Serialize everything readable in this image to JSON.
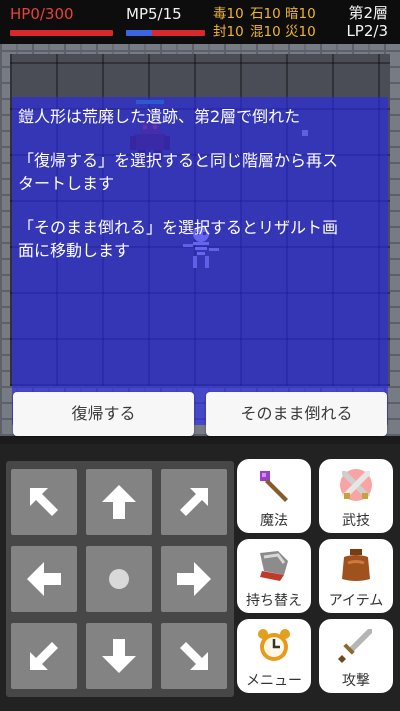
{
  "hud": {
    "hp": "HP0/300",
    "mp": "MP5/15",
    "hp_fraction": 0,
    "mp_fraction": 0.333,
    "status_row1": [
      "毒10",
      "石10",
      "暗10"
    ],
    "status_row2": [
      "封10",
      "混10",
      "災10"
    ],
    "floor": "第2層",
    "lp": "LP2/3",
    "colors": {
      "hp": "#e8413a",
      "status": "#f0b52c",
      "mp_fill": "#3a64e0",
      "bar_empty": "#d8282b"
    }
  },
  "dialog": {
    "lines": [
      "鎧人形は荒廃した遺跡、第2層で倒れた",
      "「復帰する」を選択すると同じ階層から再ス",
      "タートします",
      "「そのまま倒れる」を選択するとリザルト画",
      "面に移動します"
    ],
    "overlay_color": "#2828f0"
  },
  "choices": {
    "revive": "復帰する",
    "fall": "そのまま倒れる"
  },
  "dpad": {
    "up_left": "arrow-up-left-icon",
    "up": "arrow-up-icon",
    "up_right": "arrow-up-right-icon",
    "left": "arrow-left-icon",
    "center": "wait-dot-icon",
    "right": "arrow-right-icon",
    "down_left": "arrow-down-left-icon",
    "down": "arrow-down-icon",
    "down_right": "arrow-down-right-icon"
  },
  "actions": {
    "magic": "魔法",
    "skill": "武技",
    "swap": "持ち替え",
    "item": "アイテム",
    "menu": "メニュー",
    "attack": "攻撃"
  }
}
